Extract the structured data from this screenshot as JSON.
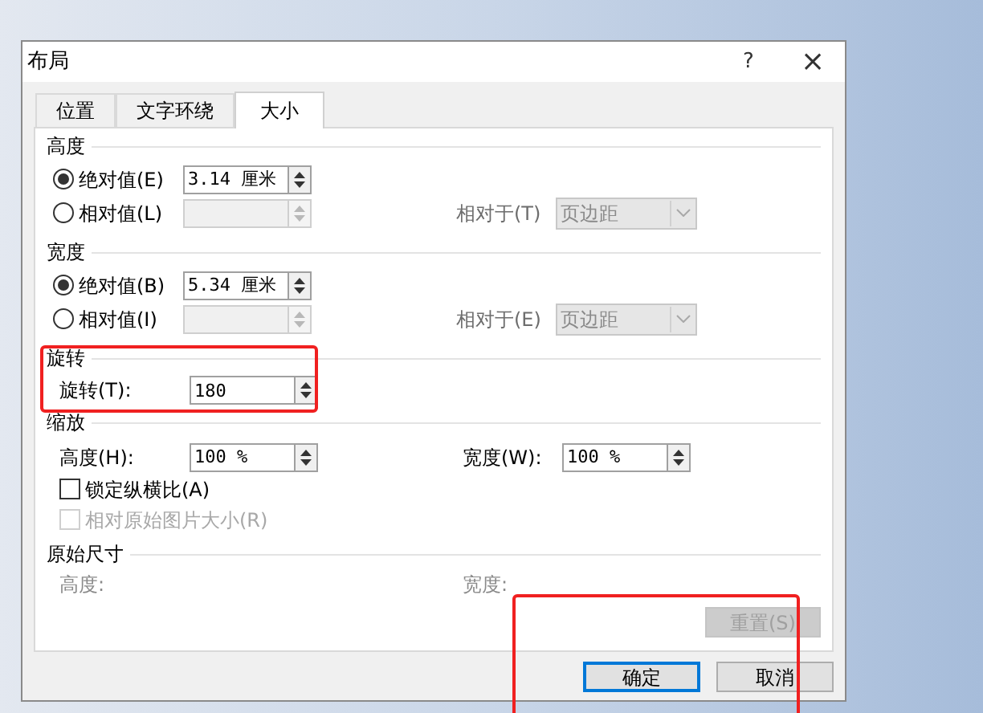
{
  "window": {
    "title": "布局",
    "help": "?",
    "close": "×"
  },
  "tabs": [
    {
      "label": "位置",
      "selected": false
    },
    {
      "label": "文字环绕",
      "selected": false
    },
    {
      "label": "大小",
      "selected": true
    }
  ],
  "height": {
    "title": "高度",
    "options": [
      {
        "label": "绝对值(E)",
        "selected": true,
        "value": "3.14 厘米",
        "disabled": false
      },
      {
        "label": "相对值(L)",
        "selected": false,
        "disabled": true
      }
    ],
    "relative_to": {
      "label": "相对于(T)",
      "value": "页边距",
      "disabled": true
    }
  },
  "width": {
    "title": "宽度",
    "options": [
      {
        "label": "绝对值(B)",
        "selected": true,
        "value": "5.34 厘米",
        "disabled": false
      },
      {
        "label": "相对值(I)",
        "selected": false,
        "disabled": true
      }
    ],
    "relative_to": {
      "label": "相对于(E)",
      "value": "页边距",
      "disabled": true
    }
  },
  "rotation": {
    "title": "旋转",
    "label": "旋转(T):",
    "value": "180"
  },
  "scale": {
    "title": "缩放",
    "height": {
      "label": "高度(H):",
      "value": "100 %"
    },
    "width": {
      "label": "宽度(W):",
      "value": "100 %"
    },
    "checkboxes": [
      {
        "label": "锁定纵横比(A)",
        "checked": false,
        "disabled": false
      },
      {
        "label": "相对原始图片大小(R)",
        "checked": false,
        "disabled": true
      }
    ]
  },
  "original_size": {
    "title": "原始尺寸",
    "height_label": "高度:",
    "width_label": "宽度:"
  },
  "reset_button": {
    "label": "重置(S)",
    "disabled": true
  },
  "buttons": [
    {
      "label": "确定",
      "default": true
    },
    {
      "label": "取消",
      "default": false
    }
  ]
}
